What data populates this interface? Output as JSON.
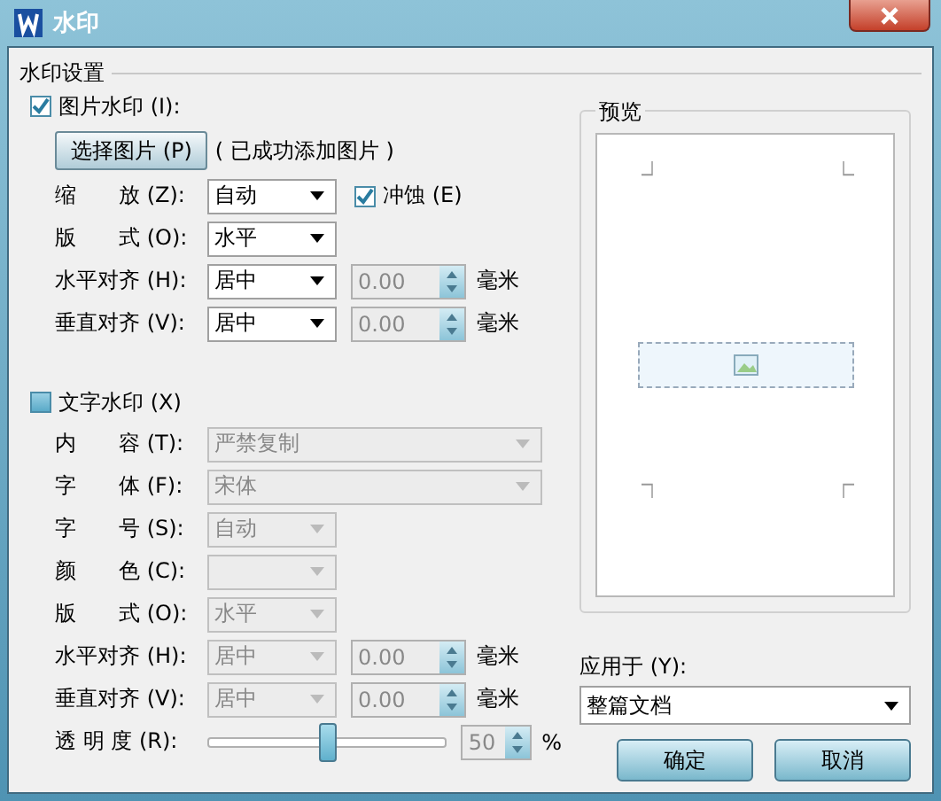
{
  "window": {
    "title": "水印"
  },
  "group_title": "水印设置",
  "image_watermark": {
    "label": "图片水印 (I):",
    "checked": true,
    "select_button": "选择图片 (P)",
    "status": "( 已成功添加图片 )",
    "rows": [
      {
        "label": "缩　　放 (Z):",
        "kind": "select",
        "value": "自动",
        "disabled": false,
        "checkbox": {
          "label": "冲蚀 (E)",
          "checked": true
        }
      },
      {
        "label": "版　　式 (O):",
        "kind": "select",
        "value": "水平",
        "disabled": false
      },
      {
        "label": "水平对齐 (H):",
        "kind": "select",
        "value": "居中",
        "disabled": false,
        "spinner": {
          "value": "0.00",
          "unit": "毫米",
          "disabled": true
        }
      },
      {
        "label": "垂直对齐 (V):",
        "kind": "select",
        "value": "居中",
        "disabled": false,
        "spinner": {
          "value": "0.00",
          "unit": "毫米",
          "disabled": true
        }
      }
    ]
  },
  "text_watermark": {
    "label": "文字水印 (X)",
    "checked": false,
    "rows": [
      {
        "label": "内　　容 (T):",
        "kind": "wide-select",
        "value": "严禁复制",
        "disabled": true
      },
      {
        "label": "字　　体 (F):",
        "kind": "wide-select",
        "value": "宋体",
        "disabled": true
      },
      {
        "label": "字　　号 (S):",
        "kind": "select",
        "value": "自动",
        "disabled": true
      },
      {
        "label": "颜　　色 (C):",
        "kind": "select",
        "disabled": true
      },
      {
        "label": "版　　式 (O):",
        "kind": "select",
        "value": "水平",
        "disabled": true
      },
      {
        "label": "水平对齐 (H):",
        "kind": "select",
        "value": "居中",
        "disabled": true,
        "spinner": {
          "value": "0.00",
          "unit": "毫米",
          "disabled": true
        }
      },
      {
        "label": "垂直对齐 (V):",
        "kind": "select",
        "value": "居中",
        "disabled": true,
        "spinner": {
          "value": "0.00",
          "unit": "毫米",
          "disabled": true
        }
      },
      {
        "label": "透 明 度 (R):",
        "kind": "slider",
        "level": 0.5,
        "spinner": {
          "value": "50",
          "unit": "%",
          "disabled": true
        }
      }
    ]
  },
  "preview": {
    "title": "预览"
  },
  "apply_to": {
    "label": "应用于 (Y):",
    "value": "整篇文档"
  },
  "buttons": [
    {
      "label": "确定"
    },
    {
      "label": "取消"
    }
  ]
}
